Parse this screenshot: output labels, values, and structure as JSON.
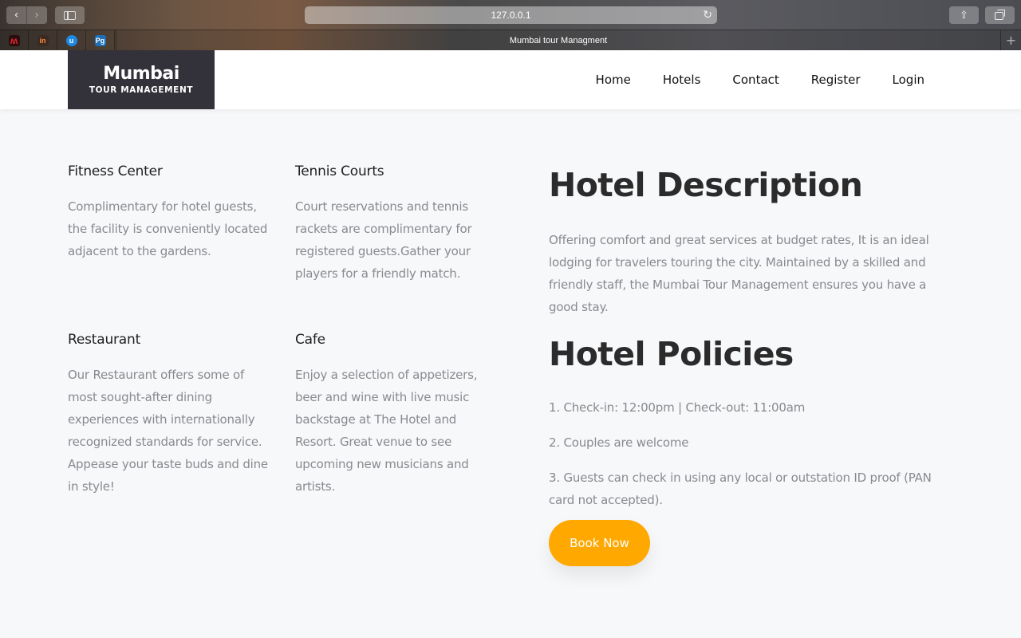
{
  "browser": {
    "url": "127.0.0.1",
    "tab_title": "Mumbai tour Managment",
    "back_icon": "chevron-left",
    "forward_icon": "chevron-right",
    "reload_icon": "reload",
    "share_icon": "share",
    "tabs_icon": "tabs-overview",
    "favorites": [
      {
        "name": "bookmark-1",
        "glyph": "ʍ",
        "color": "#c8102e"
      },
      {
        "name": "bookmark-invision",
        "glyph": "in",
        "color": "#ff8a3d"
      },
      {
        "name": "bookmark-3",
        "glyph": "u",
        "color": "#1e88e5"
      },
      {
        "name": "bookmark-pg",
        "glyph": "Pg",
        "color": "#1c6fb5"
      }
    ],
    "new_tab_label": "+"
  },
  "site": {
    "logo_title": "Mumbai",
    "logo_subtitle": "TOUR MANAGEMENT",
    "nav": [
      "Home",
      "Hotels",
      "Contact",
      "Register",
      "Login"
    ]
  },
  "amenities": [
    {
      "title": "Fitness Center",
      "text": "Complimentary for hotel guests, the facility is conveniently located adjacent to the gardens."
    },
    {
      "title": "Tennis Courts",
      "text": "Court reservations and tennis rackets are complimentary for registered guests.Gather your players for a friendly match."
    },
    {
      "title": "Restaurant",
      "text": "Our Restaurant offers some of most sought-after dining experiences with internationally recognized standards for service. Appease your taste buds and dine in style!"
    },
    {
      "title": "Cafe",
      "text": "Enjoy a selection of appetizers, beer and wine with live music backstage at The Hotel and Resort. Great venue to see upcoming new musicians and artists."
    }
  ],
  "description": {
    "title": "Hotel Description",
    "text": "Offering comfort and great services at budget rates, It is an ideal lodging for travelers touring the city. Maintained by a skilled and friendly staff, the Mumbai Tour Management ensures you have a good stay."
  },
  "policies": {
    "title": "Hotel Policies",
    "items": [
      "1. Check-in: 12:00pm | Check-out: 11:00am",
      "2. Couples are welcome",
      "3. Guests can check in using any local or outstation ID proof (PAN card not accepted)."
    ]
  },
  "book_button": "Book Now",
  "colors": {
    "accent": "#ffa800",
    "logo_bg": "#333139",
    "body_text": "#888a8f",
    "heading": "#2b2b2b"
  }
}
